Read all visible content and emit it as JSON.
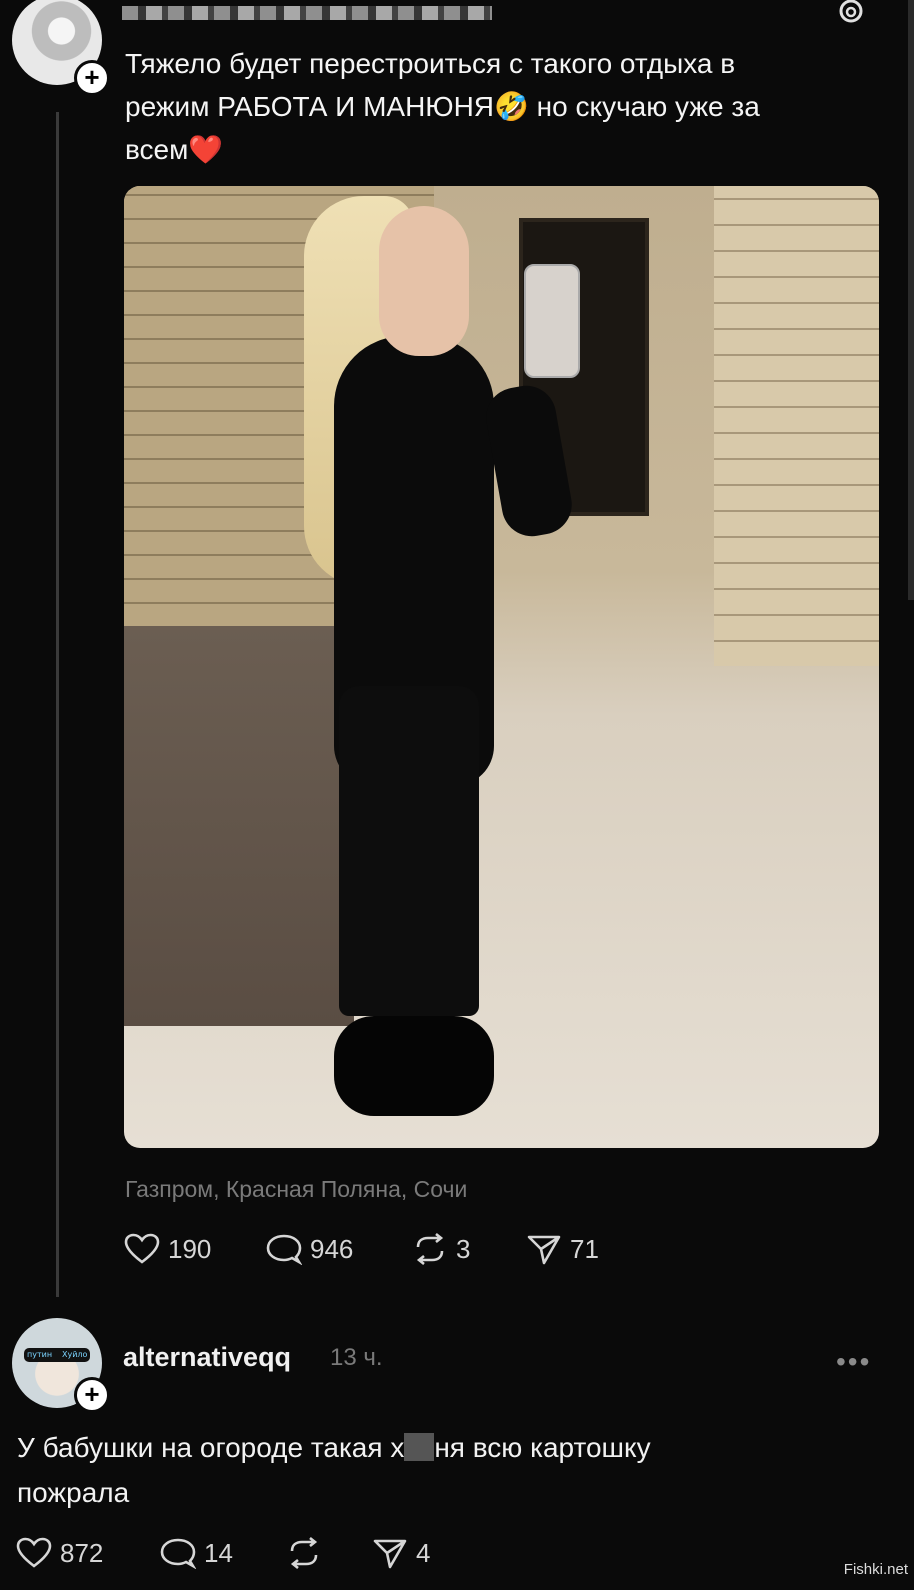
{
  "post": {
    "text_line1": "Тяжело будет перестроиться с такого отдыха в",
    "text_line2a": "режим РАБОТА И МАНЮНЯ",
    "emoji1": "🤣",
    "text_line2b": " но скучаю уже за",
    "text_line3": "всем",
    "emoji2": "❤️",
    "location": "Газпром, Красная Поляна, Сочи",
    "likes": "190",
    "comments": "946",
    "reposts": "3",
    "shares": "71"
  },
  "reply": {
    "username": "alternativeqq",
    "time": "13 ч.",
    "more": "•••",
    "text_a": "У бабушки на огороде такая х",
    "text_b": "ня всю картошку",
    "text_c": "пожрала",
    "likes": "872",
    "comments": "14",
    "reposts": "",
    "shares": "4",
    "glasses_left": "путин",
    "glasses_right": "Хуйло"
  },
  "icons": [
    "threads-icon",
    "plus-icon",
    "heart-icon",
    "comment-icon",
    "repost-icon",
    "share-icon",
    "more-icon"
  ],
  "watermark": "Fishki.net"
}
